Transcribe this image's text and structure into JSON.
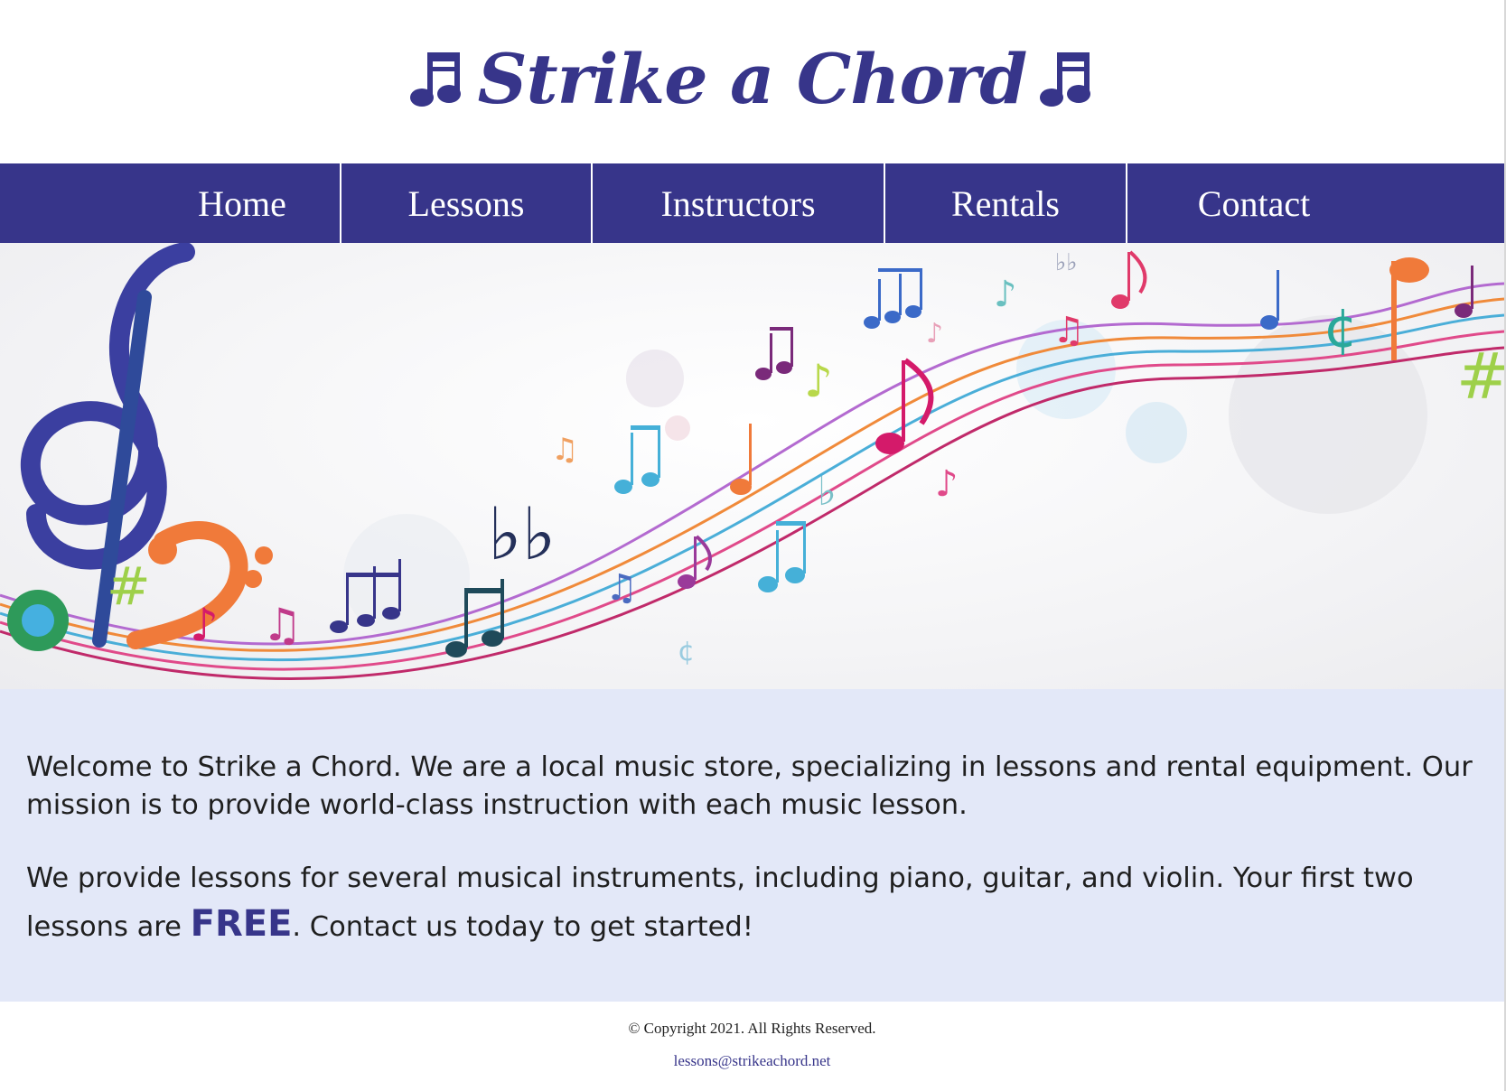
{
  "header": {
    "site_title": "Strike a Chord"
  },
  "nav": {
    "items": [
      {
        "label": "Home"
      },
      {
        "label": "Lessons"
      },
      {
        "label": "Instructors"
      },
      {
        "label": "Rentals"
      },
      {
        "label": "Contact"
      }
    ]
  },
  "main": {
    "paragraph1": "Welcome to Strike a Chord. We are a local music store, specializing in lessons and rental equipment. Our mission is to provide world-class instruction with each music lesson.",
    "paragraph2_before": "We provide lessons for several musical instruments, including piano, guitar, and violin. Your first two lessons are ",
    "paragraph2_emphasis": "FREE",
    "paragraph2_after": ". Contact us today to get started!"
  },
  "footer": {
    "copyright": "© Copyright 2021. All Rights Reserved.",
    "email": "lessons@strikeachord.net"
  },
  "colors": {
    "brand": "#37358a",
    "content_background": "#e3e8f8"
  }
}
